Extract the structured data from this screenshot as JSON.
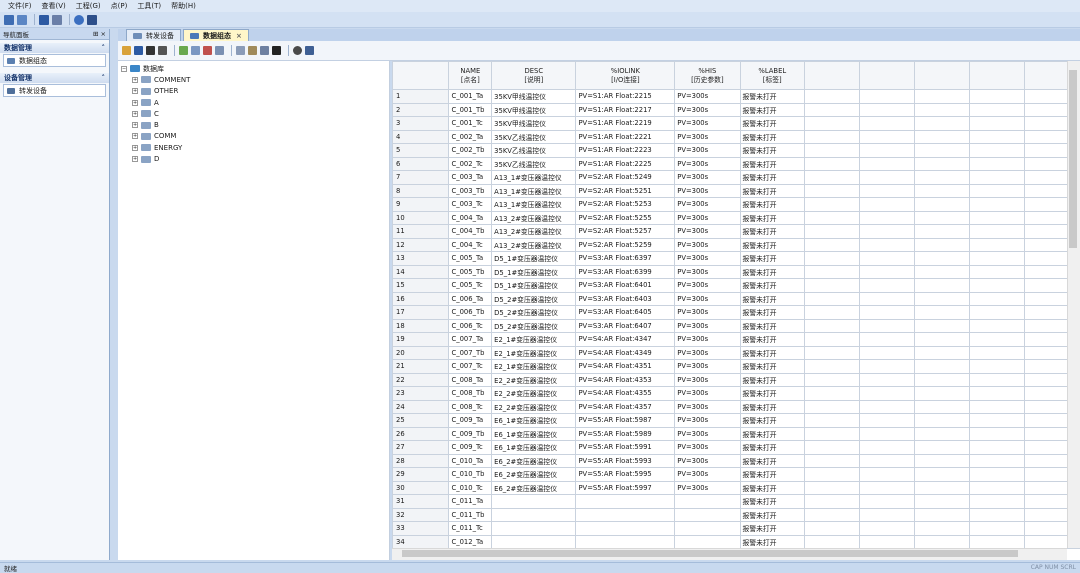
{
  "menu": [
    "文件(F)",
    "查看(V)",
    "工程(G)",
    "点(P)",
    "工具(T)",
    "帮助(H)"
  ],
  "nav": {
    "title": "导航面板",
    "pin": "⊞ ×",
    "groups": [
      {
        "header": "数据管理",
        "item": "数据组态"
      },
      {
        "header": "设备管理",
        "item": "转发设备"
      }
    ]
  },
  "tabs": [
    {
      "label": "转发设备",
      "active": false
    },
    {
      "label": "数据组态",
      "active": true,
      "close": "×"
    }
  ],
  "tree": {
    "root": "数据库",
    "children": [
      "COMMENT",
      "OTHER",
      "A",
      "C",
      "B",
      "COMM",
      "ENERGY",
      "D"
    ]
  },
  "grid": {
    "columns": [
      {
        "name": "NAME",
        "sub": "[点名]"
      },
      {
        "name": "DESC",
        "sub": "[说明]"
      },
      {
        "name": "%IOLINK",
        "sub": "[I/O连接]"
      },
      {
        "name": "%HIS",
        "sub": "[历史参数]"
      },
      {
        "name": "%LABEL",
        "sub": "[标签]"
      }
    ],
    "rows": [
      [
        "1",
        "C_001_Ta",
        "35KV甲线温控仪",
        "PV=S1:AR Float:2215",
        "PV=300s",
        "报警未打开"
      ],
      [
        "2",
        "C_001_Tb",
        "35KV甲线温控仪",
        "PV=S1:AR Float:2217",
        "PV=300s",
        "报警未打开"
      ],
      [
        "3",
        "C_001_Tc",
        "35KV甲线温控仪",
        "PV=S1:AR Float:2219",
        "PV=300s",
        "报警未打开"
      ],
      [
        "4",
        "C_002_Ta",
        "35KV乙线温控仪",
        "PV=S1:AR Float:2221",
        "PV=300s",
        "报警未打开"
      ],
      [
        "5",
        "C_002_Tb",
        "35KV乙线温控仪",
        "PV=S1:AR Float:2223",
        "PV=300s",
        "报警未打开"
      ],
      [
        "6",
        "C_002_Tc",
        "35KV乙线温控仪",
        "PV=S1:AR Float:2225",
        "PV=300s",
        "报警未打开"
      ],
      [
        "7",
        "C_003_Ta",
        "A13_1#变压器温控仪",
        "PV=S2:AR Float:5249",
        "PV=300s",
        "报警未打开"
      ],
      [
        "8",
        "C_003_Tb",
        "A13_1#变压器温控仪",
        "PV=S2:AR Float:5251",
        "PV=300s",
        "报警未打开"
      ],
      [
        "9",
        "C_003_Tc",
        "A13_1#变压器温控仪",
        "PV=S2:AR Float:5253",
        "PV=300s",
        "报警未打开"
      ],
      [
        "10",
        "C_004_Ta",
        "A13_2#变压器温控仪",
        "PV=S2:AR Float:5255",
        "PV=300s",
        "报警未打开"
      ],
      [
        "11",
        "C_004_Tb",
        "A13_2#变压器温控仪",
        "PV=S2:AR Float:5257",
        "PV=300s",
        "报警未打开"
      ],
      [
        "12",
        "C_004_Tc",
        "A13_2#变压器温控仪",
        "PV=S2:AR Float:5259",
        "PV=300s",
        "报警未打开"
      ],
      [
        "13",
        "C_005_Ta",
        "D5_1#变压器温控仪",
        "PV=S3:AR Float:6397",
        "PV=300s",
        "报警未打开"
      ],
      [
        "14",
        "C_005_Tb",
        "D5_1#变压器温控仪",
        "PV=S3:AR Float:6399",
        "PV=300s",
        "报警未打开"
      ],
      [
        "15",
        "C_005_Tc",
        "D5_1#变压器温控仪",
        "PV=S3:AR Float:6401",
        "PV=300s",
        "报警未打开"
      ],
      [
        "16",
        "C_006_Ta",
        "D5_2#变压器温控仪",
        "PV=S3:AR Float:6403",
        "PV=300s",
        "报警未打开"
      ],
      [
        "17",
        "C_006_Tb",
        "D5_2#变压器温控仪",
        "PV=S3:AR Float:6405",
        "PV=300s",
        "报警未打开"
      ],
      [
        "18",
        "C_006_Tc",
        "D5_2#变压器温控仪",
        "PV=S3:AR Float:6407",
        "PV=300s",
        "报警未打开"
      ],
      [
        "19",
        "C_007_Ta",
        "E2_1#变压器温控仪",
        "PV=S4:AR Float:4347",
        "PV=300s",
        "报警未打开"
      ],
      [
        "20",
        "C_007_Tb",
        "E2_1#变压器温控仪",
        "PV=S4:AR Float:4349",
        "PV=300s",
        "报警未打开"
      ],
      [
        "21",
        "C_007_Tc",
        "E2_1#变压器温控仪",
        "PV=S4:AR Float:4351",
        "PV=300s",
        "报警未打开"
      ],
      [
        "22",
        "C_008_Ta",
        "E2_2#变压器温控仪",
        "PV=S4:AR Float:4353",
        "PV=300s",
        "报警未打开"
      ],
      [
        "23",
        "C_008_Tb",
        "E2_2#变压器温控仪",
        "PV=S4:AR Float:4355",
        "PV=300s",
        "报警未打开"
      ],
      [
        "24",
        "C_008_Tc",
        "E2_2#变压器温控仪",
        "PV=S4:AR Float:4357",
        "PV=300s",
        "报警未打开"
      ],
      [
        "25",
        "C_009_Ta",
        "E6_1#变压器温控仪",
        "PV=S5:AR Float:5987",
        "PV=300s",
        "报警未打开"
      ],
      [
        "26",
        "C_009_Tb",
        "E6_1#变压器温控仪",
        "PV=S5:AR Float:5989",
        "PV=300s",
        "报警未打开"
      ],
      [
        "27",
        "C_009_Tc",
        "E6_1#变压器温控仪",
        "PV=S5:AR Float:5991",
        "PV=300s",
        "报警未打开"
      ],
      [
        "28",
        "C_010_Ta",
        "E6_2#变压器温控仪",
        "PV=S5:AR Float:5993",
        "PV=300s",
        "报警未打开"
      ],
      [
        "29",
        "C_010_Tb",
        "E6_2#变压器温控仪",
        "PV=S5:AR Float:5995",
        "PV=300s",
        "报警未打开"
      ],
      [
        "30",
        "C_010_Tc",
        "E6_2#变压器温控仪",
        "PV=S5:AR Float:5997",
        "PV=300s",
        "报警未打开"
      ],
      [
        "31",
        "C_011_Ta",
        "",
        "",
        "",
        "报警未打开"
      ],
      [
        "32",
        "C_011_Tb",
        "",
        "",
        "",
        "报警未打开"
      ],
      [
        "33",
        "C_011_Tc",
        "",
        "",
        "",
        "报警未打开"
      ],
      [
        "34",
        "C_012_Ta",
        "",
        "",
        "",
        "报警未打开"
      ]
    ]
  },
  "status": {
    "left": "就绪",
    "right": "CAP NUM SCRL"
  },
  "colors": {
    "accent": "#c9d9ee",
    "tab_active": "#fff6c9",
    "group_header": "#15346b"
  }
}
